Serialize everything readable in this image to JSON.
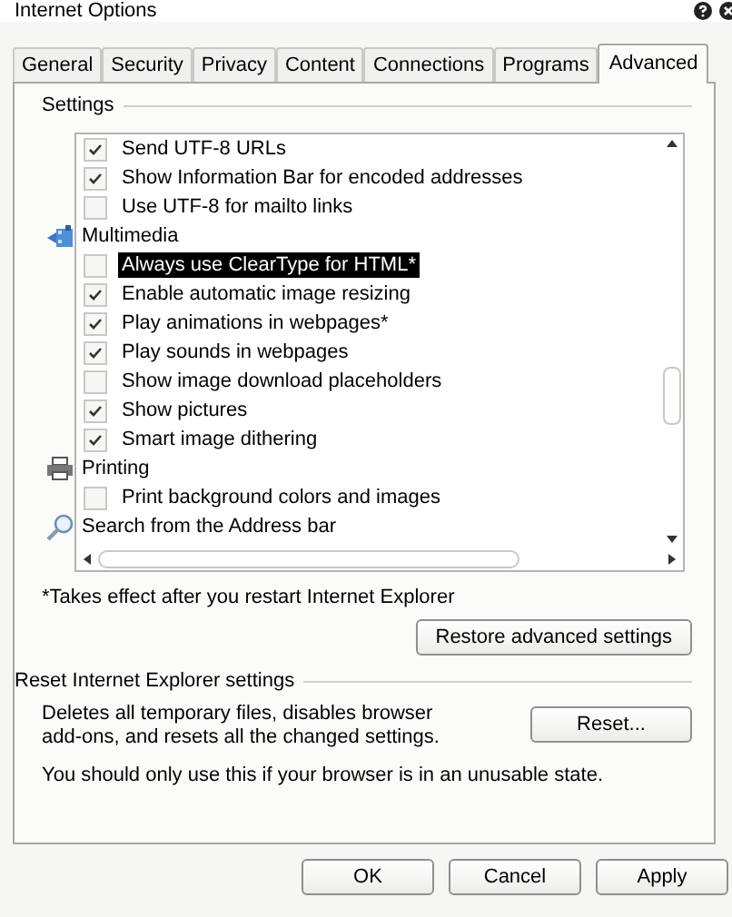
{
  "window": {
    "title": "Internet Options"
  },
  "tabs": [
    {
      "label": "General",
      "selected": false
    },
    {
      "label": "Security",
      "selected": false
    },
    {
      "label": "Privacy",
      "selected": false
    },
    {
      "label": "Content",
      "selected": false
    },
    {
      "label": "Connections",
      "selected": false
    },
    {
      "label": "Programs",
      "selected": false
    },
    {
      "label": "Advanced",
      "selected": true
    }
  ],
  "settings": {
    "title": "Settings",
    "items": [
      {
        "kind": "check",
        "label": "Send UTF-8 URLs",
        "checked": true,
        "selected": false
      },
      {
        "kind": "check",
        "label": "Show Information Bar for encoded addresses",
        "checked": true,
        "selected": false
      },
      {
        "kind": "check",
        "label": "Use UTF-8 for mailto links",
        "checked": false,
        "selected": false
      },
      {
        "kind": "category",
        "label": "Multimedia"
      },
      {
        "kind": "check",
        "label": "Always use ClearType for HTML*",
        "checked": false,
        "selected": true
      },
      {
        "kind": "check",
        "label": "Enable automatic image resizing",
        "checked": true,
        "selected": false
      },
      {
        "kind": "check",
        "label": "Play animations in webpages*",
        "checked": true,
        "selected": false
      },
      {
        "kind": "check",
        "label": "Play sounds in webpages",
        "checked": true,
        "selected": false
      },
      {
        "kind": "check",
        "label": "Show image download placeholders",
        "checked": false,
        "selected": false
      },
      {
        "kind": "check",
        "label": "Show pictures",
        "checked": true,
        "selected": false
      },
      {
        "kind": "check",
        "label": "Smart image dithering",
        "checked": true,
        "selected": false
      },
      {
        "kind": "category",
        "label": "Printing"
      },
      {
        "kind": "check",
        "label": "Print background colors and images",
        "checked": false,
        "selected": false
      },
      {
        "kind": "category",
        "label": "Search from the Address bar"
      }
    ],
    "note": "*Takes effect after you restart Internet Explorer",
    "restore_button": "Restore advanced settings"
  },
  "reset": {
    "title": "Reset Internet Explorer settings",
    "description": "Deletes all temporary files, disables browser add-ons, and resets all the changed settings.",
    "button": "Reset...",
    "warning": "You should only use this if your browser is in an unusable state."
  },
  "buttons": [
    "OK",
    "Cancel",
    "Apply"
  ]
}
